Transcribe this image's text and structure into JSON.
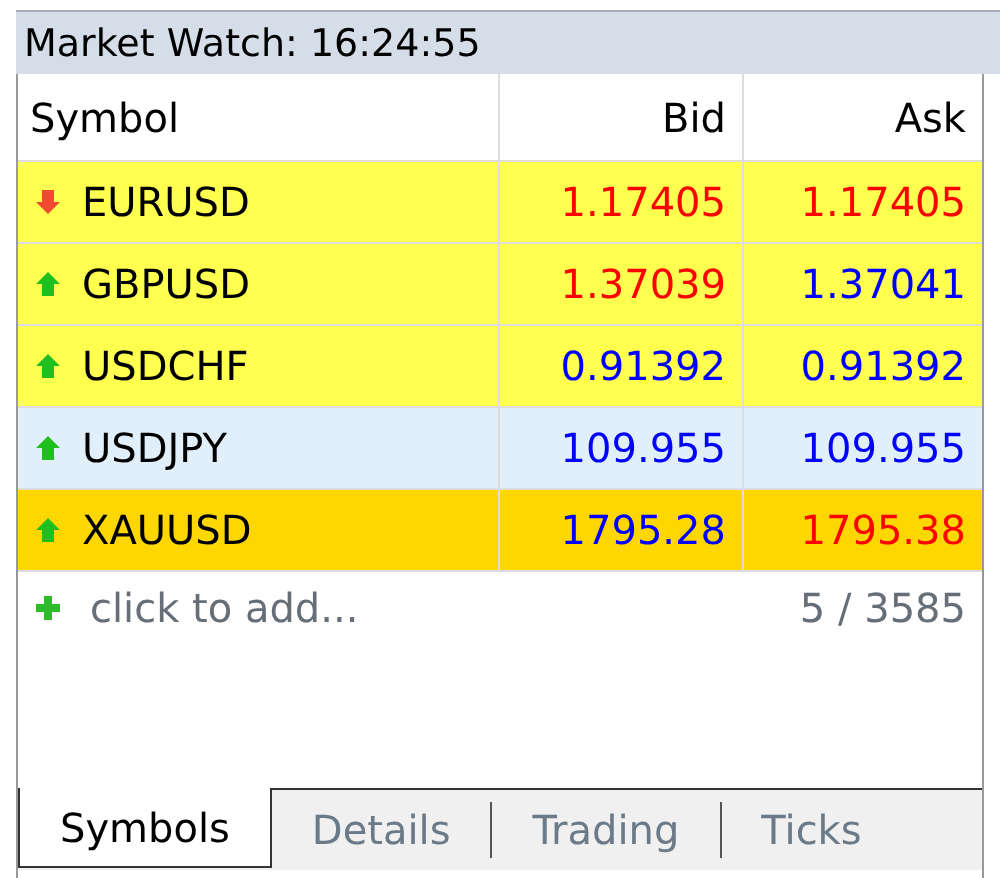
{
  "window": {
    "title": "Market Watch: 16:24:55"
  },
  "table": {
    "columns": [
      "Symbol",
      "Bid",
      "Ask"
    ],
    "rows": [
      {
        "kind": "down",
        "symbol": "EURUSD",
        "color": "#ffff4f",
        "bid": {
          "text": "1.17405",
          "color": "#ff0000"
        },
        "ask": {
          "text": "1.17405",
          "color": "#ff0000"
        }
      },
      {
        "kind": "up",
        "symbol": "GBPUSD",
        "color": "#ffff4f",
        "bid": {
          "text": "1.37039",
          "color": "#ff0000"
        },
        "ask": {
          "text": "1.37041",
          "color": "#0000ff"
        }
      },
      {
        "kind": "up",
        "symbol": "USDCHF",
        "color": "#ffff4f",
        "bid": {
          "text": "0.91392",
          "color": "#0000ff"
        },
        "ask": {
          "text": "0.91392",
          "color": "#0000ff"
        }
      },
      {
        "kind": "up",
        "symbol": "USDJPY",
        "color": "#e1effa",
        "bid": {
          "text": "109.955",
          "color": "#0000ff"
        },
        "ask": {
          "text": "109.955",
          "color": "#0000ff"
        }
      },
      {
        "kind": "up",
        "symbol": "XAUUSD",
        "color": "#ffd700",
        "bid": {
          "text": "1795.28",
          "color": "#0000ff"
        },
        "ask": {
          "text": "1795.38",
          "color": "#ff0000"
        }
      }
    ],
    "add_row": {
      "label": "click to add...",
      "count": "5 / 3585"
    }
  },
  "tabs": [
    {
      "label": "Symbols",
      "selected": true
    },
    {
      "label": "Details",
      "selected": false
    },
    {
      "label": "Trading",
      "selected": false
    },
    {
      "label": "Ticks",
      "selected": false
    }
  ]
}
